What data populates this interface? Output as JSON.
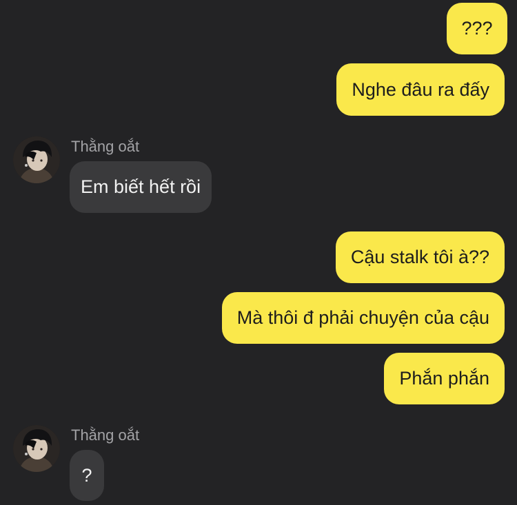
{
  "theme": {
    "background": "#232325",
    "outgoing_bubble": "#FAE84B",
    "incoming_bubble": "#3A3A3C",
    "sender_name_color": "#A3A3A6"
  },
  "messages": [
    {
      "direction": "out",
      "text": "???"
    },
    {
      "direction": "out",
      "text": "Nghe đâu ra đấy"
    },
    {
      "direction": "in",
      "sender": "Thằng oắt",
      "avatar_icon": "user-avatar",
      "text": "Em biết hết rồi"
    },
    {
      "direction": "out",
      "text": "Cậu stalk tôi à??"
    },
    {
      "direction": "out",
      "text": "Mà thôi đ phải chuyện của cậu"
    },
    {
      "direction": "out",
      "text": "Phắn phắn"
    },
    {
      "direction": "in",
      "sender": "Thằng oắt",
      "avatar_icon": "user-avatar",
      "text": "?"
    }
  ]
}
